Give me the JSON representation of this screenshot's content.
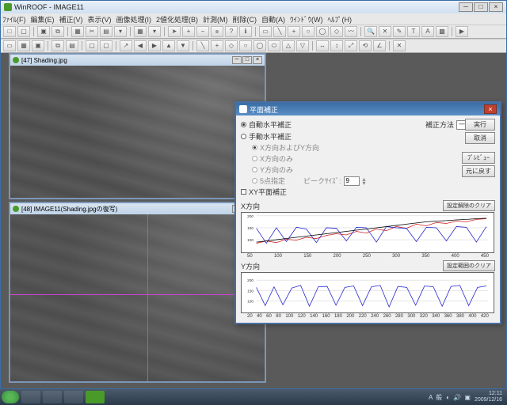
{
  "app_title": "WinROOF - IMAGE11",
  "menu": [
    "ﾌｧｲﾙ(F)",
    "編集(E)",
    "補正(V)",
    "表示(V)",
    "画像処理(I)",
    "2値化処理(B)",
    "計測(M)",
    "削除(C)",
    "自動(A)",
    "ｳｲﾝﾄﾞｳ(W)",
    "ﾍﾙﾌﾟ(H)"
  ],
  "child1_title": "[47] Shading.jpg",
  "child2_title": "[48] IMAGE11(Shading.jpgの復写)",
  "dialog": {
    "title": "平面補正",
    "opt_auto": "自動水平補正",
    "opt_manual": "手動水平補正",
    "method_label": "補正方法",
    "method_value": "一次補正",
    "sub1": "X方向およびY方向",
    "sub2": "X方向のみ",
    "sub3": "Y方向のみ",
    "sub4": "5点指定",
    "peak_label": "ピークｻｲｽﾞ:",
    "peak_value": "9",
    "checkbox": "XY平面補正",
    "btn_run": "実行",
    "btn_cancel": "取消",
    "btn_preview": "ﾌﾟﾚﾋﾞｭｰ",
    "btn_reset": "元に戻す",
    "btn_clear": "設定解除のクリア",
    "btn_clear2": "設定範囲のクリア",
    "x_label": "X方向",
    "y_label": "Y方向"
  },
  "chart_data": [
    {
      "type": "line",
      "title": "X方向",
      "ylim": [
        60,
        200
      ],
      "xlim": [
        20,
        460
      ],
      "y_ticks": [
        100,
        150,
        200
      ],
      "x_ticks": [
        50,
        100,
        150,
        200,
        250,
        300,
        350,
        400,
        450
      ],
      "series": [
        {
          "name": "red",
          "color": "#d02020",
          "values": [
            85,
            95,
            88,
            102,
            98,
            110,
            105,
            118,
            125,
            120,
            135,
            128,
            145,
            138,
            155,
            148,
            165,
            158,
            172,
            168,
            178,
            175,
            185,
            188
          ]
        },
        {
          "name": "blue",
          "color": "#2020d0",
          "values": [
            148,
            85,
            150,
            92,
            152,
            145,
            88,
            150,
            148,
            95,
            152,
            150,
            90,
            155,
            150,
            148,
            92,
            152,
            150,
            95,
            155,
            152,
            90,
            155
          ]
        },
        {
          "name": "black",
          "color": "#000",
          "values": [
            90,
            95,
            100,
            105,
            110,
            115,
            120,
            125,
            130,
            135,
            140,
            145,
            150,
            155,
            160,
            165,
            170,
            175,
            178,
            180,
            183,
            185,
            188,
            190
          ]
        }
      ]
    },
    {
      "type": "line",
      "title": "Y方向",
      "ylim": [
        60,
        220
      ],
      "xlim": [
        20,
        430
      ],
      "y_ticks": [
        100,
        150,
        200
      ],
      "x_ticks": [
        20,
        40,
        60,
        80,
        100,
        120,
        140,
        160,
        180,
        200,
        220,
        240,
        260,
        280,
        300,
        320,
        340,
        360,
        380,
        400,
        420
      ],
      "series": [
        {
          "name": "blue",
          "color": "#2020d0",
          "values": [
            165,
            78,
            168,
            82,
            162,
            175,
            75,
            168,
            170,
            80,
            165,
            172,
            78,
            168,
            175,
            72,
            170,
            165,
            80,
            172,
            168,
            75,
            170,
            175,
            78,
            165,
            172
          ]
        }
      ]
    }
  ],
  "taskbar": {
    "time": "12:11",
    "date": "2009/12/16",
    "tray_text": "A 般"
  }
}
